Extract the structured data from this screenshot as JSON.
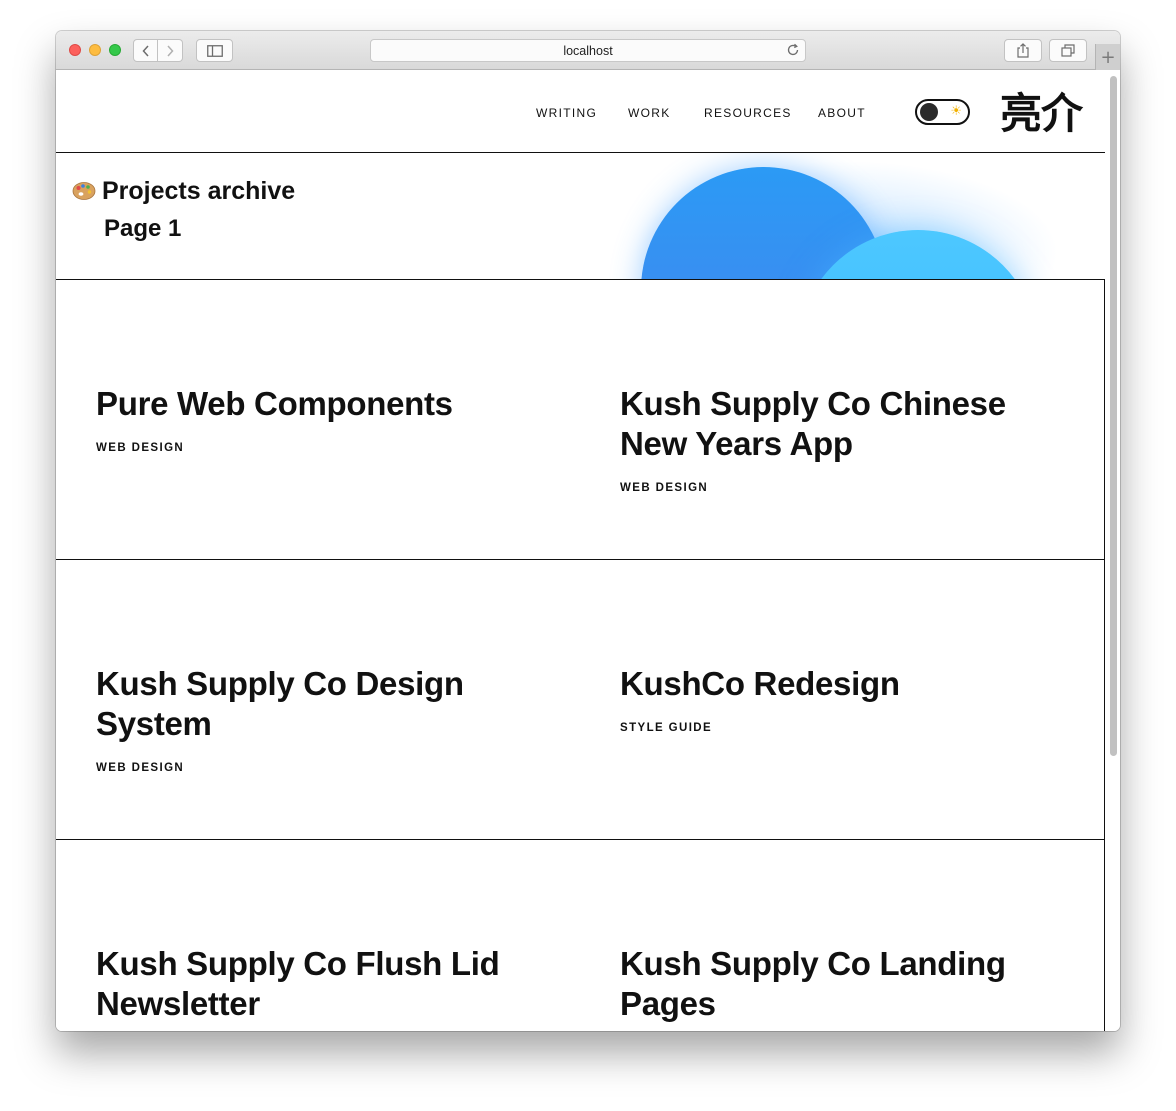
{
  "browser": {
    "url": "localhost"
  },
  "header": {
    "nav": [
      "WRITING",
      "WORK",
      "RESOURCES",
      "ABOUT"
    ],
    "logo": "亮介"
  },
  "hero": {
    "title": "Projects archive",
    "subtitle": "Page 1"
  },
  "projects": [
    {
      "title": "Pure Web Components",
      "tag": "WEB DESIGN"
    },
    {
      "title": "Kush Supply Co Chinese New Years App",
      "tag": "WEB DESIGN"
    },
    {
      "title": "Kush Supply Co Design System",
      "tag": "WEB DESIGN"
    },
    {
      "title": "KushCo Redesign",
      "tag": "STYLE GUIDE"
    },
    {
      "title": "Kush Supply Co Flush Lid Newsletter",
      "tag": ""
    },
    {
      "title": "Kush Supply Co Landing Pages",
      "tag": ""
    }
  ],
  "colors": {
    "blob_primary": "#2b9af5",
    "blob_secondary": "#4dc8ff",
    "text": "#111111"
  }
}
